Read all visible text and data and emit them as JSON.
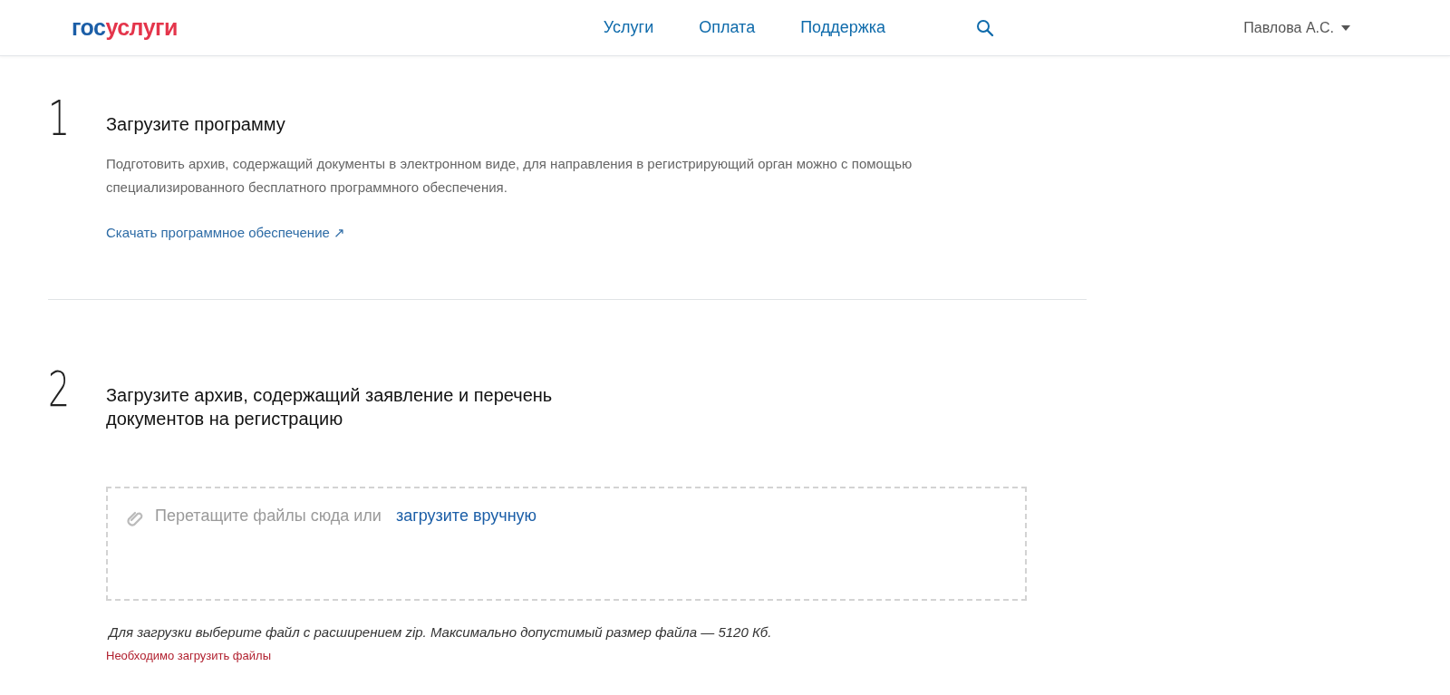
{
  "header": {
    "logo": {
      "first": "гос",
      "second": "услуги"
    },
    "nav": [
      {
        "label": "Услуги"
      },
      {
        "label": "Оплата"
      },
      {
        "label": "Поддержка"
      }
    ],
    "user": "Павлова А.С."
  },
  "steps": [
    {
      "number": "1",
      "title": "Загрузите программу",
      "text": "Подготовить архив, содержащий документы в электронном виде, для направления в регистрирующий орган можно с помощью специализированного бесплатного программного обеспечения.",
      "link": "Скачать программное обеспечение ↗"
    },
    {
      "number": "2",
      "title": "Загрузите архив, содержащий заявление и перечень документов на регистрацию"
    }
  ],
  "upload": {
    "prompt": "Перетащите файлы сюда или",
    "link": "загрузите вручную",
    "hint": "Для загрузки выберите файл с расширением zip. Максимально допустимый размер файла — 5120 Кб.",
    "error": "Необходимо загрузить файлы"
  }
}
